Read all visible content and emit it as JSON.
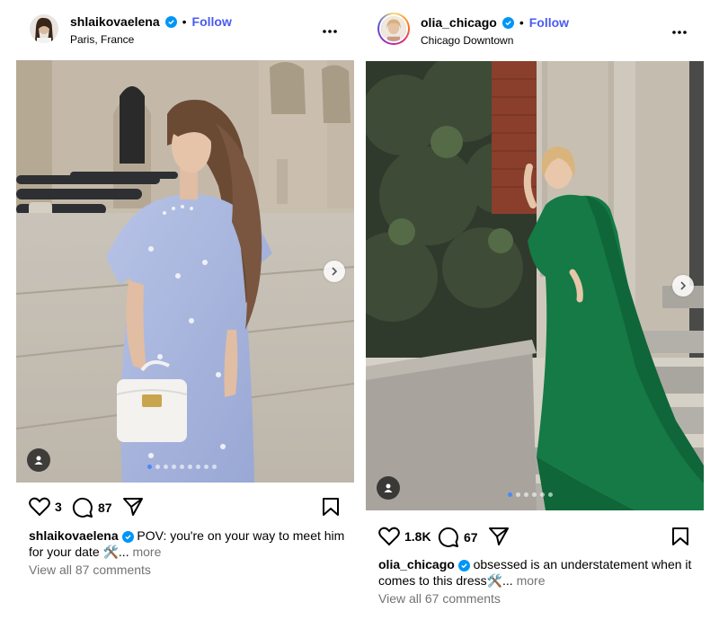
{
  "posts": [
    {
      "username": "shlaikovaelena",
      "follow_label": "Follow",
      "separator": "•",
      "location": "Paris, France",
      "more_label": "•••",
      "likes": "3",
      "comments_count": "87",
      "caption_user": "shlaikovaelena",
      "caption_text": "POV: you're on your way to meet him for your date 🛠️...",
      "caption_more": "more",
      "view_comments": "View all 87 comments",
      "carousel_count": 9,
      "carousel_active": 0
    },
    {
      "username": "olia_chicago",
      "follow_label": "Follow",
      "separator": "•",
      "location": "Chicago Downtown",
      "more_label": "•••",
      "likes": "1.8K",
      "comments_count": "67",
      "caption_user": "olia_chicago",
      "caption_text": "obsessed is an understatement when it comes to this dress🛠️...",
      "caption_more": "more",
      "view_comments": "View all 67 comments",
      "carousel_count": 6,
      "carousel_active": 0
    }
  ],
  "colors": {
    "follow": "#4a5cf0",
    "verified": "#0095f6",
    "muted": "#737373"
  },
  "icons": [
    "verified-badge-icon",
    "heart-icon",
    "comment-icon",
    "share-icon",
    "bookmark-icon",
    "chevron-right-icon",
    "user-tag-icon",
    "more-icon"
  ]
}
